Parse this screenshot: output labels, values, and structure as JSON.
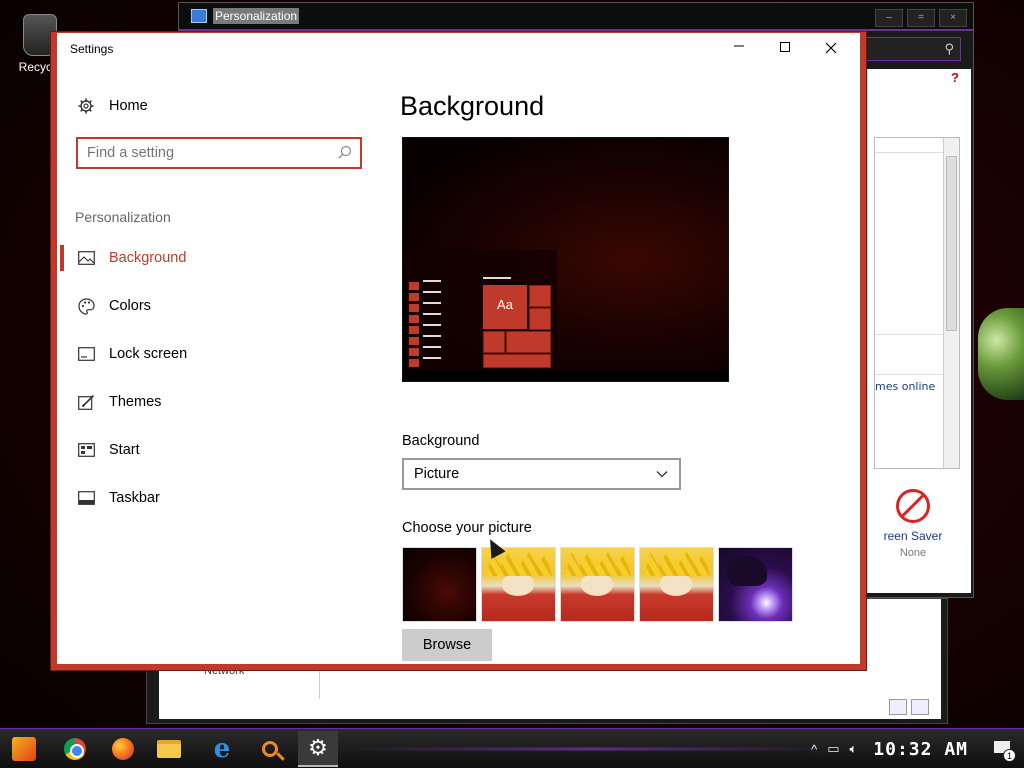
{
  "desktop": {
    "recycle_label": "Recycle"
  },
  "control_panel": {
    "title": "Personalization",
    "link_text": "mes online",
    "screen_saver_label": "reen Saver",
    "screen_saver_value": "None",
    "lower_text": "Network"
  },
  "settings": {
    "window_title": "Settings",
    "nav": {
      "home": "Home",
      "search_placeholder": "Find a setting",
      "group_label": "Personalization",
      "items": [
        {
          "label": "Background",
          "icon": "picture-icon",
          "active": true
        },
        {
          "label": "Colors",
          "icon": "palette-icon",
          "active": false
        },
        {
          "label": "Lock screen",
          "icon": "lock-screen-icon",
          "active": false
        },
        {
          "label": "Themes",
          "icon": "themes-icon",
          "active": false
        },
        {
          "label": "Start",
          "icon": "start-icon",
          "active": false
        },
        {
          "label": "Taskbar",
          "icon": "taskbar-icon",
          "active": false
        }
      ]
    },
    "main": {
      "title": "Background",
      "preview_tile_text": "Aa",
      "background_label": "Background",
      "background_value": "Picture",
      "choose_label": "Choose your picture",
      "browse_label": "Browse"
    },
    "accent_color": "#c03a2b"
  },
  "taskbar": {
    "time": "10:32 AM",
    "notification_count": "1",
    "apps": [
      "start",
      "chrome",
      "firefox",
      "file-explorer",
      "internet-explorer",
      "search",
      "settings"
    ]
  }
}
